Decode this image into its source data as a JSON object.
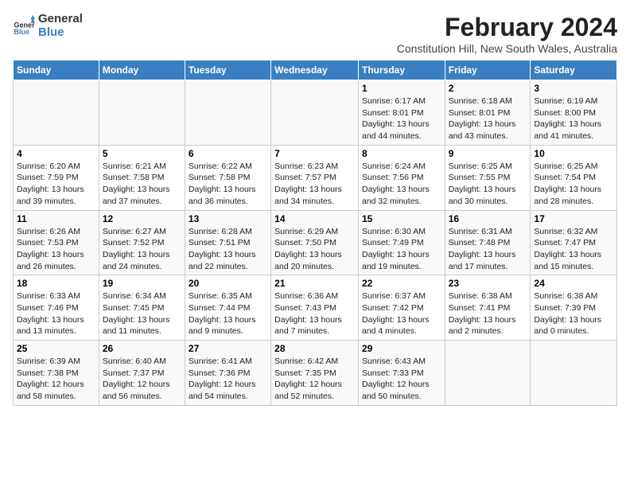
{
  "header": {
    "logo_general": "General",
    "logo_blue": "Blue",
    "month_year": "February 2024",
    "location": "Constitution Hill, New South Wales, Australia"
  },
  "days_of_week": [
    "Sunday",
    "Monday",
    "Tuesday",
    "Wednesday",
    "Thursday",
    "Friday",
    "Saturday"
  ],
  "weeks": [
    [
      {
        "date": "",
        "info": ""
      },
      {
        "date": "",
        "info": ""
      },
      {
        "date": "",
        "info": ""
      },
      {
        "date": "",
        "info": ""
      },
      {
        "date": "1",
        "info": "Sunrise: 6:17 AM\nSunset: 8:01 PM\nDaylight: 13 hours\nand 44 minutes."
      },
      {
        "date": "2",
        "info": "Sunrise: 6:18 AM\nSunset: 8:01 PM\nDaylight: 13 hours\nand 43 minutes."
      },
      {
        "date": "3",
        "info": "Sunrise: 6:19 AM\nSunset: 8:00 PM\nDaylight: 13 hours\nand 41 minutes."
      }
    ],
    [
      {
        "date": "4",
        "info": "Sunrise: 6:20 AM\nSunset: 7:59 PM\nDaylight: 13 hours\nand 39 minutes."
      },
      {
        "date": "5",
        "info": "Sunrise: 6:21 AM\nSunset: 7:58 PM\nDaylight: 13 hours\nand 37 minutes."
      },
      {
        "date": "6",
        "info": "Sunrise: 6:22 AM\nSunset: 7:58 PM\nDaylight: 13 hours\nand 36 minutes."
      },
      {
        "date": "7",
        "info": "Sunrise: 6:23 AM\nSunset: 7:57 PM\nDaylight: 13 hours\nand 34 minutes."
      },
      {
        "date": "8",
        "info": "Sunrise: 6:24 AM\nSunset: 7:56 PM\nDaylight: 13 hours\nand 32 minutes."
      },
      {
        "date": "9",
        "info": "Sunrise: 6:25 AM\nSunset: 7:55 PM\nDaylight: 13 hours\nand 30 minutes."
      },
      {
        "date": "10",
        "info": "Sunrise: 6:25 AM\nSunset: 7:54 PM\nDaylight: 13 hours\nand 28 minutes."
      }
    ],
    [
      {
        "date": "11",
        "info": "Sunrise: 6:26 AM\nSunset: 7:53 PM\nDaylight: 13 hours\nand 26 minutes."
      },
      {
        "date": "12",
        "info": "Sunrise: 6:27 AM\nSunset: 7:52 PM\nDaylight: 13 hours\nand 24 minutes."
      },
      {
        "date": "13",
        "info": "Sunrise: 6:28 AM\nSunset: 7:51 PM\nDaylight: 13 hours\nand 22 minutes."
      },
      {
        "date": "14",
        "info": "Sunrise: 6:29 AM\nSunset: 7:50 PM\nDaylight: 13 hours\nand 20 minutes."
      },
      {
        "date": "15",
        "info": "Sunrise: 6:30 AM\nSunset: 7:49 PM\nDaylight: 13 hours\nand 19 minutes."
      },
      {
        "date": "16",
        "info": "Sunrise: 6:31 AM\nSunset: 7:48 PM\nDaylight: 13 hours\nand 17 minutes."
      },
      {
        "date": "17",
        "info": "Sunrise: 6:32 AM\nSunset: 7:47 PM\nDaylight: 13 hours\nand 15 minutes."
      }
    ],
    [
      {
        "date": "18",
        "info": "Sunrise: 6:33 AM\nSunset: 7:46 PM\nDaylight: 13 hours\nand 13 minutes."
      },
      {
        "date": "19",
        "info": "Sunrise: 6:34 AM\nSunset: 7:45 PM\nDaylight: 13 hours\nand 11 minutes."
      },
      {
        "date": "20",
        "info": "Sunrise: 6:35 AM\nSunset: 7:44 PM\nDaylight: 13 hours\nand 9 minutes."
      },
      {
        "date": "21",
        "info": "Sunrise: 6:36 AM\nSunset: 7:43 PM\nDaylight: 13 hours\nand 7 minutes."
      },
      {
        "date": "22",
        "info": "Sunrise: 6:37 AM\nSunset: 7:42 PM\nDaylight: 13 hours\nand 4 minutes."
      },
      {
        "date": "23",
        "info": "Sunrise: 6:38 AM\nSunset: 7:41 PM\nDaylight: 13 hours\nand 2 minutes."
      },
      {
        "date": "24",
        "info": "Sunrise: 6:38 AM\nSunset: 7:39 PM\nDaylight: 13 hours\nand 0 minutes."
      }
    ],
    [
      {
        "date": "25",
        "info": "Sunrise: 6:39 AM\nSunset: 7:38 PM\nDaylight: 12 hours\nand 58 minutes."
      },
      {
        "date": "26",
        "info": "Sunrise: 6:40 AM\nSunset: 7:37 PM\nDaylight: 12 hours\nand 56 minutes."
      },
      {
        "date": "27",
        "info": "Sunrise: 6:41 AM\nSunset: 7:36 PM\nDaylight: 12 hours\nand 54 minutes."
      },
      {
        "date": "28",
        "info": "Sunrise: 6:42 AM\nSunset: 7:35 PM\nDaylight: 12 hours\nand 52 minutes."
      },
      {
        "date": "29",
        "info": "Sunrise: 6:43 AM\nSunset: 7:33 PM\nDaylight: 12 hours\nand 50 minutes."
      },
      {
        "date": "",
        "info": ""
      },
      {
        "date": "",
        "info": ""
      }
    ]
  ]
}
